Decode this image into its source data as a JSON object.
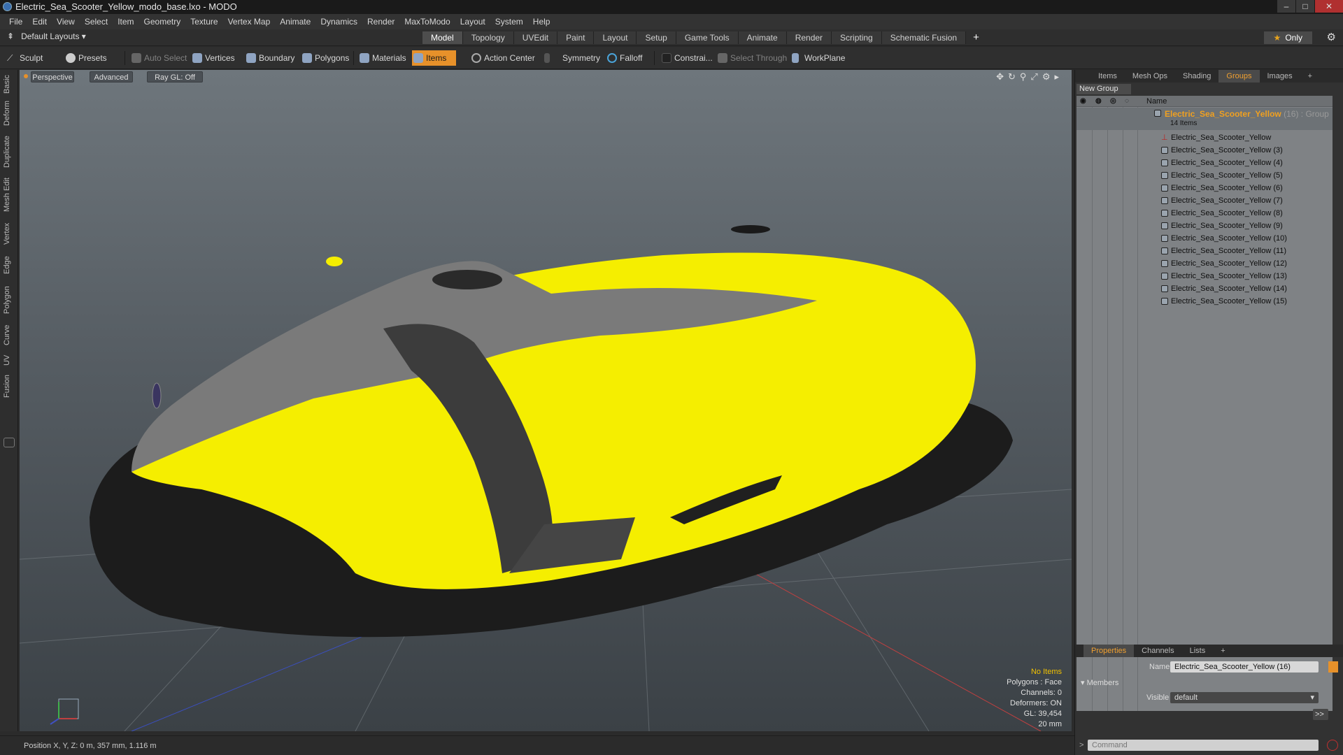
{
  "window": {
    "title": "Electric_Sea_Scooter_Yellow_modo_base.lxo - MODO"
  },
  "menu": [
    "File",
    "Edit",
    "View",
    "Select",
    "Item",
    "Geometry",
    "Texture",
    "Vertex Map",
    "Animate",
    "Dynamics",
    "Render",
    "MaxToModo",
    "Layout",
    "System",
    "Help"
  ],
  "layouts": {
    "label": "Default Layouts ▾"
  },
  "mode_tabs": [
    "Model",
    "Topology",
    "UVEdit",
    "Paint",
    "Layout",
    "Setup",
    "Game Tools",
    "Animate",
    "Render",
    "Scripting",
    "Schematic Fusion"
  ],
  "only_label": "Only",
  "toolbar": {
    "sculpt": "Sculpt",
    "presets": "Presets",
    "auto_select": "Auto Select",
    "vertices": "Vertices",
    "boundary": "Boundary",
    "polygons": "Polygons",
    "materials": "Materials",
    "items": "Items",
    "action_center": "Action Center",
    "symmetry": "Symmetry",
    "falloff": "Falloff",
    "constraints": "Constrai...",
    "select_through": "Select Through",
    "workplane": "WorkPlane"
  },
  "left_tabs": [
    "Basic",
    "Deform",
    "Duplicate",
    "Mesh Edit",
    "Vertex",
    "Edge",
    "Polygon",
    "Curve",
    "UV",
    "Fusion"
  ],
  "viewport": {
    "view": "Perspective",
    "shading": "Advanced",
    "raygl": "Ray GL: Off",
    "stats": {
      "no_items": "No Items",
      "polygons": "Polygons : Face",
      "channels": "Channels: 0",
      "deformers": "Deformers: ON",
      "gl": "GL: 39,454",
      "scale": "20 mm"
    }
  },
  "status": {
    "position": "Position X, Y, Z:  0 m, 357 mm, 1.116 m"
  },
  "panel": {
    "tabs": [
      "Items",
      "Mesh Ops",
      "Shading",
      "Groups",
      "Images"
    ],
    "new_group": "New Group",
    "name_col": "Name",
    "group": {
      "name": "Electric_Sea_Scooter_Yellow",
      "count": " (16) : Group",
      "sub": "14 Items"
    },
    "items": [
      "Electric_Sea_Scooter_Yellow",
      "Electric_Sea_Scooter_Yellow (3)",
      "Electric_Sea_Scooter_Yellow (4)",
      "Electric_Sea_Scooter_Yellow (5)",
      "Electric_Sea_Scooter_Yellow (6)",
      "Electric_Sea_Scooter_Yellow (7)",
      "Electric_Sea_Scooter_Yellow (8)",
      "Electric_Sea_Scooter_Yellow (9)",
      "Electric_Sea_Scooter_Yellow (10)",
      "Electric_Sea_Scooter_Yellow (11)",
      "Electric_Sea_Scooter_Yellow (12)",
      "Electric_Sea_Scooter_Yellow (13)",
      "Electric_Sea_Scooter_Yellow (14)",
      "Electric_Sea_Scooter_Yellow (15)"
    ]
  },
  "properties": {
    "tabs": [
      "Properties",
      "Channels",
      "Lists"
    ],
    "name_label": "Name",
    "name_value": "Electric_Sea_Scooter_Yellow (16)",
    "members": "Members",
    "visible_label": "Visible",
    "visible_value": "default",
    "more": ">>"
  },
  "command": {
    "placeholder": "Command"
  },
  "colors": {
    "accent": "#e7912a",
    "group_text": "#f0a020",
    "model_yellow": "#f5ee00"
  }
}
